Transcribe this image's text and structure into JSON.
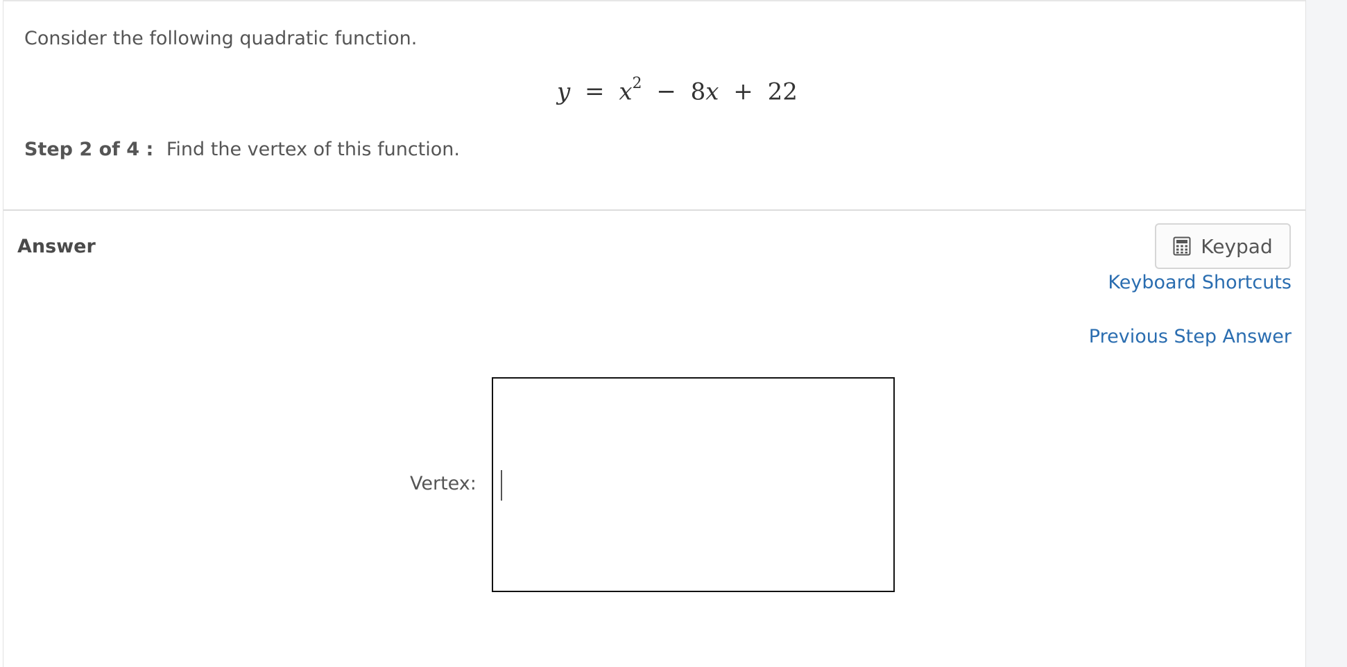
{
  "question": {
    "intro": "Consider the following quadratic function.",
    "equation": {
      "lhs": "y",
      "equals": "=",
      "term1_var": "x",
      "term1_exp": "2",
      "op1": "−",
      "term2": "8",
      "term2_var": "x",
      "op2": "+",
      "term3": "22"
    },
    "step_label": "Step 2 of 4 :",
    "step_text": "Find the vertex of this function."
  },
  "answer": {
    "heading": "Answer",
    "keypad_label": "Keypad",
    "keyboard_shortcuts_label": "Keyboard Shortcuts",
    "previous_step_label": "Previous Step Answer",
    "vertex_label": "Vertex:",
    "vertex_value": ""
  },
  "icons": {
    "keypad": "calculator-icon"
  },
  "colors": {
    "link": "#2a6db0",
    "text": "#555555",
    "input_border": "#111111"
  }
}
